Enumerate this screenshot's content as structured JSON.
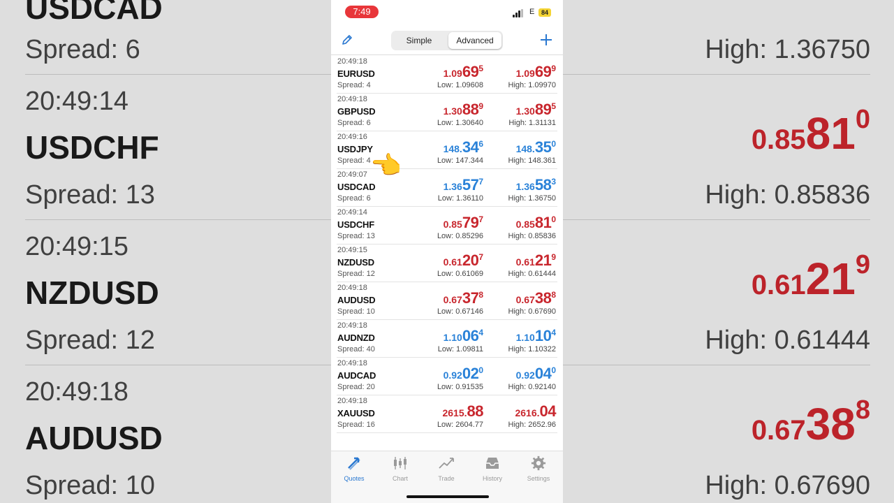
{
  "status_bar": {
    "time": "7:49",
    "network": "E",
    "battery": "84"
  },
  "toolbar": {
    "edit_icon": "pencil-icon",
    "mode_simple": "Simple",
    "mode_advanced": "Advanced",
    "active_mode": "Advanced",
    "add_icon": "plus-icon"
  },
  "quotes": [
    {
      "time": "20:49:18",
      "symbol": "EURUSD",
      "spread": "Spread: 4",
      "color": "red",
      "bid": {
        "p1": "1.09",
        "p2": "69",
        "p3": "5"
      },
      "ask": {
        "p1": "1.09",
        "p2": "69",
        "p3": "9"
      },
      "low": "Low: 1.09608",
      "high": "High: 1.09970"
    },
    {
      "time": "20:49:18",
      "symbol": "GBPUSD",
      "spread": "Spread: 6",
      "color": "red",
      "bid": {
        "p1": "1.30",
        "p2": "88",
        "p3": "9"
      },
      "ask": {
        "p1": "1.30",
        "p2": "89",
        "p3": "5"
      },
      "low": "Low: 1.30640",
      "high": "High: 1.31131"
    },
    {
      "time": "20:49:16",
      "symbol": "USDJPY",
      "spread": "Spread: 4",
      "color": "blue",
      "bid": {
        "p1": "148.",
        "p2": "34",
        "p3": "6"
      },
      "ask": {
        "p1": "148.",
        "p2": "35",
        "p3": "0"
      },
      "low": "Low: 147.344",
      "high": "High: 148.361"
    },
    {
      "time": "20:49:07",
      "symbol": "USDCAD",
      "spread": "Spread: 6",
      "color": "blue",
      "bid": {
        "p1": "1.36",
        "p2": "57",
        "p3": "7"
      },
      "ask": {
        "p1": "1.36",
        "p2": "58",
        "p3": "3"
      },
      "low": "Low: 1.36110",
      "high": "High: 1.36750"
    },
    {
      "time": "20:49:14",
      "symbol": "USDCHF",
      "spread": "Spread: 13",
      "color": "red",
      "bid": {
        "p1": "0.85",
        "p2": "79",
        "p3": "7"
      },
      "ask": {
        "p1": "0.85",
        "p2": "81",
        "p3": "0"
      },
      "low": "Low: 0.85296",
      "high": "High: 0.85836"
    },
    {
      "time": "20:49:15",
      "symbol": "NZDUSD",
      "spread": "Spread: 12",
      "color": "red",
      "bid": {
        "p1": "0.61",
        "p2": "20",
        "p3": "7"
      },
      "ask": {
        "p1": "0.61",
        "p2": "21",
        "p3": "9"
      },
      "low": "Low: 0.61069",
      "high": "High: 0.61444"
    },
    {
      "time": "20:49:18",
      "symbol": "AUDUSD",
      "spread": "Spread: 10",
      "color": "red",
      "bid": {
        "p1": "0.67",
        "p2": "37",
        "p3": "8"
      },
      "ask": {
        "p1": "0.67",
        "p2": "38",
        "p3": "8"
      },
      "low": "Low: 0.67146",
      "high": "High: 0.67690"
    },
    {
      "time": "20:49:18",
      "symbol": "AUDNZD",
      "spread": "Spread: 40",
      "color": "blue",
      "bid": {
        "p1": "1.10",
        "p2": "06",
        "p3": "4"
      },
      "ask": {
        "p1": "1.10",
        "p2": "10",
        "p3": "4"
      },
      "low": "Low: 1.09811",
      "high": "High: 1.10322"
    },
    {
      "time": "20:49:18",
      "symbol": "AUDCAD",
      "spread": "Spread: 20",
      "color": "blue",
      "bid": {
        "p1": "0.92",
        "p2": "02",
        "p3": "0"
      },
      "ask": {
        "p1": "0.92",
        "p2": "04",
        "p3": "0"
      },
      "low": "Low: 0.91535",
      "high": "High: 0.92140"
    },
    {
      "time": "20:49:18",
      "symbol": "XAUUSD",
      "spread": "Spread: 16",
      "color": "red",
      "bid": {
        "p1": "2615.",
        "p2": "88",
        "p3": ""
      },
      "ask": {
        "p1": "2616.",
        "p2": "04",
        "p3": ""
      },
      "low": "Low: 2604.77",
      "high": "High: 2652.96"
    }
  ],
  "tabs": [
    {
      "label": "Quotes",
      "icon": "quotes-icon",
      "active": true
    },
    {
      "label": "Chart",
      "icon": "candlestick-icon",
      "active": false
    },
    {
      "label": "Trade",
      "icon": "trend-icon",
      "active": false
    },
    {
      "label": "History",
      "icon": "inbox-icon",
      "active": false
    },
    {
      "label": "Settings",
      "icon": "gear-icon",
      "active": false
    }
  ],
  "colors": {
    "red": "#c8262d",
    "blue": "#2a82d8",
    "accent": "#2a78d0",
    "status_pill": "#e8363a"
  }
}
